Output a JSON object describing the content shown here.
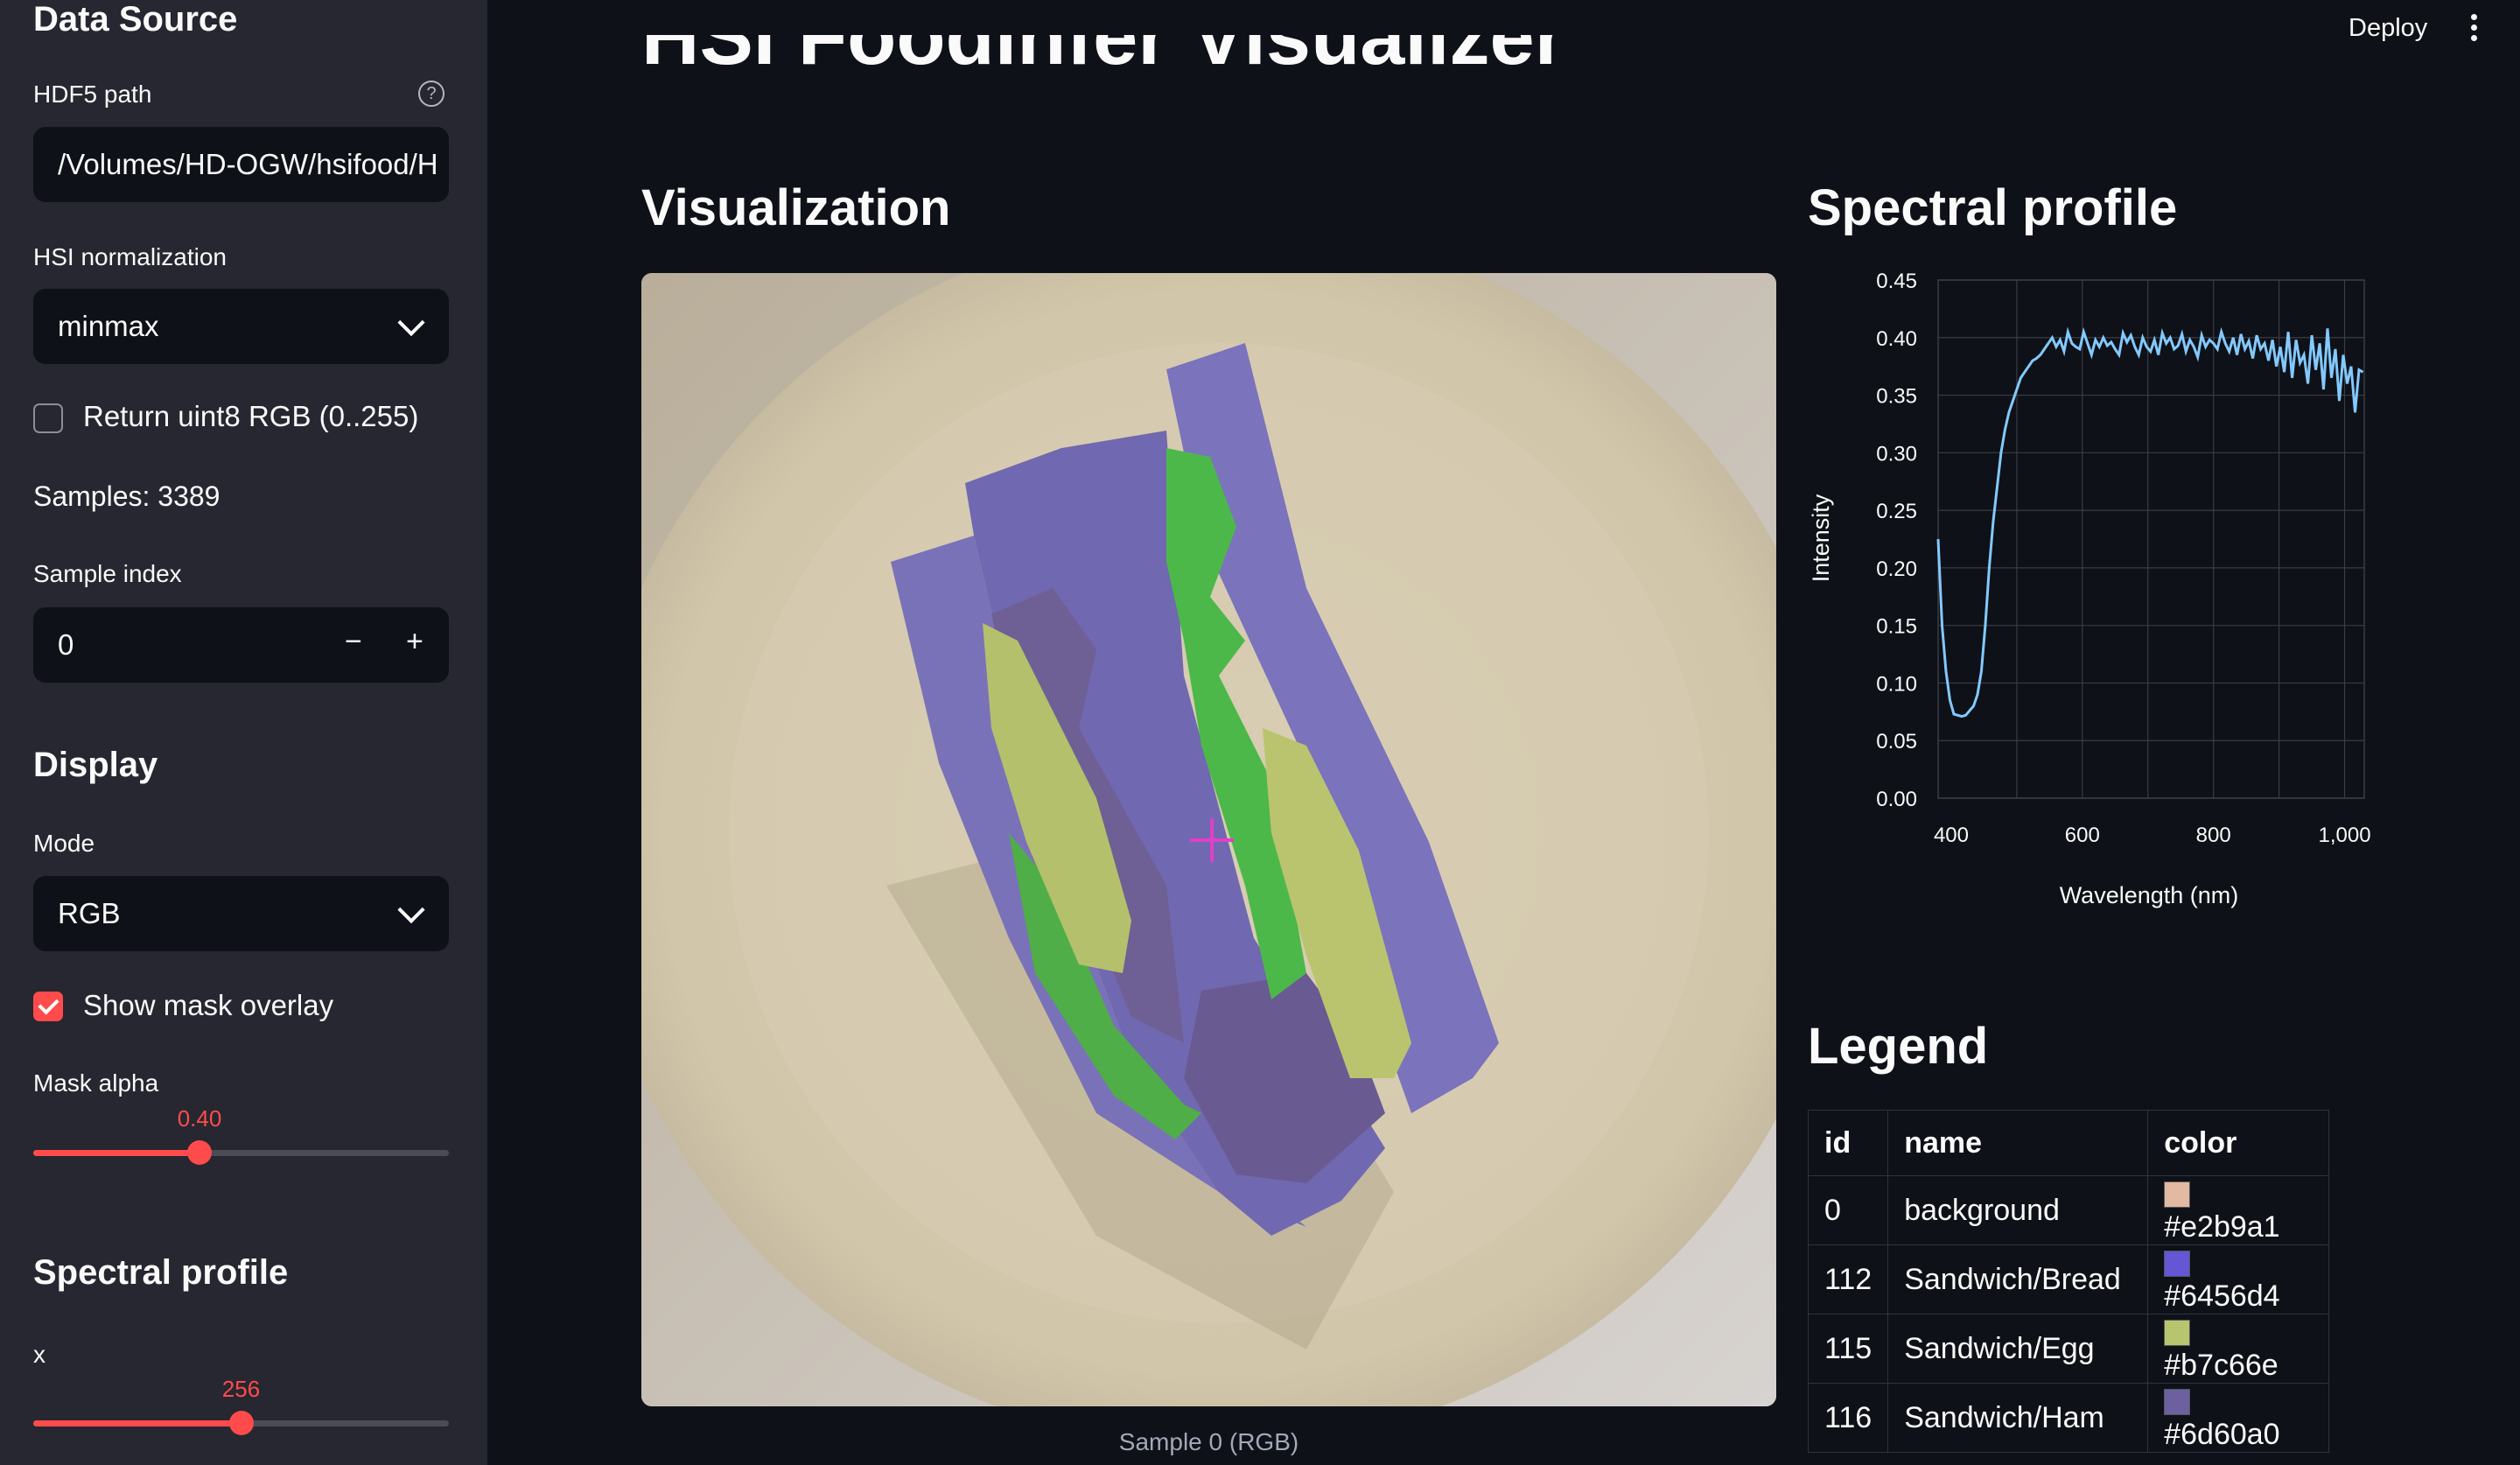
{
  "sidebar": {
    "data_source_heading": "Data Source",
    "hdf5_label": "HDF5 path",
    "hdf5_value": "/Volumes/HD-OGW/hsifood/H",
    "help_glyph": "?",
    "normalization_label": "HSI normalization",
    "normalization_value": "minmax",
    "uint8_label": "Return uint8 RGB (0..255)",
    "uint8_checked": false,
    "samples_text": "Samples: 3389",
    "sample_index_label": "Sample index",
    "sample_index_value": "0",
    "minus": "−",
    "plus": "+",
    "display_heading": "Display",
    "mode_label": "Mode",
    "mode_value": "RGB",
    "mask_overlay_label": "Show mask overlay",
    "mask_overlay_checked": true,
    "mask_alpha_label": "Mask alpha",
    "mask_alpha_value": "0.40",
    "mask_alpha_fraction": 0.4,
    "spectral_heading": "Spectral profile",
    "x_label": "x",
    "x_value": "256",
    "x_fraction": 0.5
  },
  "header": {
    "deploy_label": "Deploy",
    "menu_icon": "kebab-icon"
  },
  "main": {
    "title": "HSI Foodinfer Visualizer",
    "viz_heading": "Visualization",
    "spectral_heading": "Spectral profile",
    "caption": "Sample 0 (RGB)",
    "crosshair_icon": "crosshair-icon",
    "crosshair_color": "#e040c8",
    "legend_heading": "Legend",
    "legend": {
      "columns": [
        "id",
        "name",
        "color"
      ],
      "rows": [
        {
          "id": "0",
          "name": "background",
          "color": "#e2b9a1"
        },
        {
          "id": "112",
          "name": "Sandwich/Bread",
          "color": "#6456d4"
        },
        {
          "id": "115",
          "name": "Sandwich/Egg",
          "color": "#b7c66e"
        },
        {
          "id": "116",
          "name": "Sandwich/Ham",
          "color": "#6d60a0"
        }
      ]
    }
  },
  "chart_data": {
    "type": "line",
    "title": "",
    "xlabel": "Wavelength (nm)",
    "ylabel": "Intensity",
    "xlim": [
      380,
      1030
    ],
    "ylim": [
      0,
      0.45
    ],
    "x_ticks": [
      400,
      600,
      800,
      1000
    ],
    "x_tick_labels": [
      "400",
      "600",
      "800",
      "1,000"
    ],
    "y_ticks": [
      0,
      0.05,
      0.1,
      0.15,
      0.2,
      0.25,
      0.3,
      0.35,
      0.4,
      0.45
    ],
    "y_tick_labels": [
      "0.00",
      "0.05",
      "0.10",
      "0.15",
      "0.20",
      "0.25",
      "0.30",
      "0.35",
      "0.40",
      "0.45"
    ],
    "grid": true,
    "line_color": "#83c9ff",
    "series": [
      {
        "x": [
          380,
          386,
          392,
          398,
          404,
          410,
          416,
          422,
          428,
          434,
          440,
          446,
          452,
          458,
          464,
          470,
          476,
          482,
          488,
          494,
          500,
          506,
          512,
          518,
          524,
          530,
          536,
          542,
          548,
          554,
          560,
          566,
          572,
          578,
          584,
          590,
          596,
          602,
          608,
          614,
          620,
          626,
          632,
          638,
          644,
          650,
          656,
          662,
          668,
          674,
          680,
          686,
          692,
          698,
          704,
          710,
          716,
          722,
          728,
          734,
          740,
          746,
          752,
          758,
          764,
          770,
          776,
          782,
          788,
          794,
          800,
          806,
          812,
          818,
          824,
          830,
          836,
          842,
          848,
          854,
          860,
          866,
          872,
          878,
          884,
          890,
          896,
          902,
          908,
          914,
          920,
          926,
          932,
          938,
          944,
          950,
          956,
          962,
          968,
          974,
          980,
          986,
          992,
          998,
          1004,
          1010,
          1016,
          1022,
          1028
        ],
        "y": [
          0.225,
          0.15,
          0.11,
          0.085,
          0.073,
          0.072,
          0.071,
          0.072,
          0.076,
          0.08,
          0.09,
          0.11,
          0.15,
          0.2,
          0.24,
          0.27,
          0.3,
          0.32,
          0.335,
          0.345,
          0.355,
          0.365,
          0.37,
          0.375,
          0.38,
          0.382,
          0.385,
          0.39,
          0.395,
          0.4,
          0.392,
          0.398,
          0.388,
          0.405,
          0.395,
          0.392,
          0.39,
          0.405,
          0.395,
          0.385,
          0.398,
          0.392,
          0.4,
          0.393,
          0.396,
          0.39,
          0.385,
          0.404,
          0.396,
          0.402,
          0.392,
          0.385,
          0.4,
          0.392,
          0.388,
          0.398,
          0.385,
          0.404,
          0.395,
          0.4,
          0.39,
          0.393,
          0.403,
          0.388,
          0.398,
          0.392,
          0.383,
          0.402,
          0.392,
          0.398,
          0.395,
          0.39,
          0.405,
          0.395,
          0.388,
          0.4,
          0.385,
          0.403,
          0.39,
          0.397,
          0.382,
          0.402,
          0.39,
          0.395,
          0.38,
          0.398,
          0.375,
          0.392,
          0.37,
          0.405,
          0.365,
          0.398,
          0.378,
          0.385,
          0.36,
          0.402,
          0.372,
          0.395,
          0.355,
          0.408,
          0.365,
          0.39,
          0.345,
          0.385,
          0.36,
          0.375,
          0.335,
          0.372,
          0.37
        ]
      }
    ]
  }
}
